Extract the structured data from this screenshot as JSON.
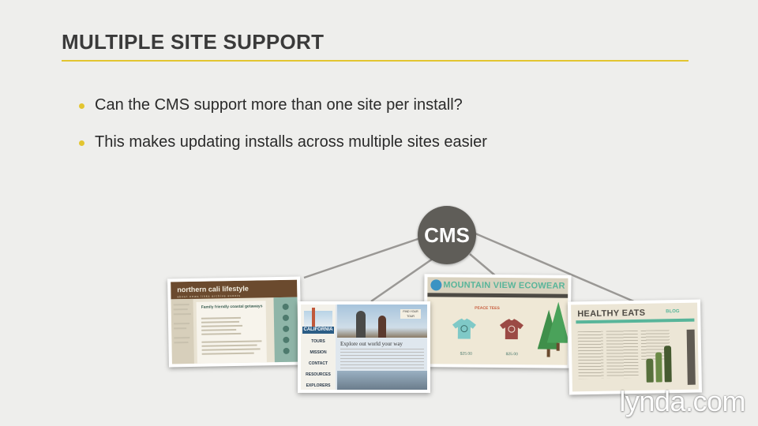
{
  "slide": {
    "title": "MULTIPLE SITE SUPPORT",
    "bullets": [
      "Can the CMS support more than one site per install?",
      "This makes updating installs across multiple sites easier"
    ],
    "accent_color": "#e3c530"
  },
  "diagram": {
    "hub_label": "CMS",
    "hub_color": "#5f5d58",
    "sites": [
      {
        "name": "northern cali lifestyle",
        "nav": "about  news  links  archive  events",
        "subheading": "Family friendly coastal getaways"
      },
      {
        "name": "CALIFORNIA",
        "menu": [
          "TOURS",
          "MISSION",
          "CONTACT",
          "RESOURCES",
          "EXPLORERS"
        ],
        "heading": "Explore out world your way",
        "sign": "FIND YOUR TOUR"
      },
      {
        "name": "MOUNTAIN VIEW ECOWEAR",
        "subheading": "PEACE TEES",
        "prices": [
          "$25.00",
          "$25.00"
        ]
      },
      {
        "name": "HEALTHY EATS",
        "tag": "BLOG"
      }
    ]
  },
  "brand": {
    "logo_text": "lynda.com"
  }
}
